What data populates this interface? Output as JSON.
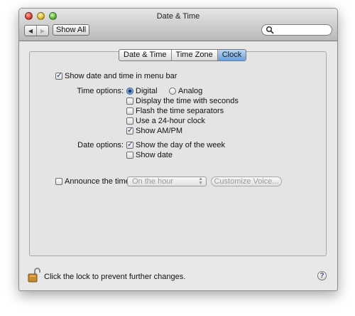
{
  "window": {
    "title": "Date & Time",
    "show_all": "Show All",
    "search_placeholder": ""
  },
  "tabs": [
    {
      "label": "Date & Time",
      "active": false
    },
    {
      "label": "Time Zone",
      "active": false
    },
    {
      "label": "Clock",
      "active": true
    }
  ],
  "clock": {
    "show_in_menu_bar": {
      "label": "Show date and time in menu bar",
      "checked": true
    },
    "time_options_label": "Time options:",
    "digital": {
      "label": "Digital",
      "selected": true
    },
    "analog": {
      "label": "Analog",
      "selected": false
    },
    "display_seconds": {
      "label": "Display the time with seconds",
      "checked": false
    },
    "flash_separators": {
      "label": "Flash the time separators",
      "checked": false
    },
    "use_24_hour": {
      "label": "Use a 24-hour clock",
      "checked": false
    },
    "show_ampm": {
      "label": "Show AM/PM",
      "checked": true
    },
    "date_options_label": "Date options:",
    "show_day_of_week": {
      "label": "Show the day of the week",
      "checked": true
    },
    "show_date": {
      "label": "Show date",
      "checked": false
    },
    "announce": {
      "label": "Announce the time:",
      "checked": false
    },
    "announce_interval": "On the hour",
    "customize_voice": "Customize Voice..."
  },
  "footer": {
    "lock_text": "Click the lock to prevent further changes.",
    "help_label": "?"
  },
  "colors": {
    "active_tab": "#6aa0d8",
    "window_bg": "#e8e8e8"
  }
}
